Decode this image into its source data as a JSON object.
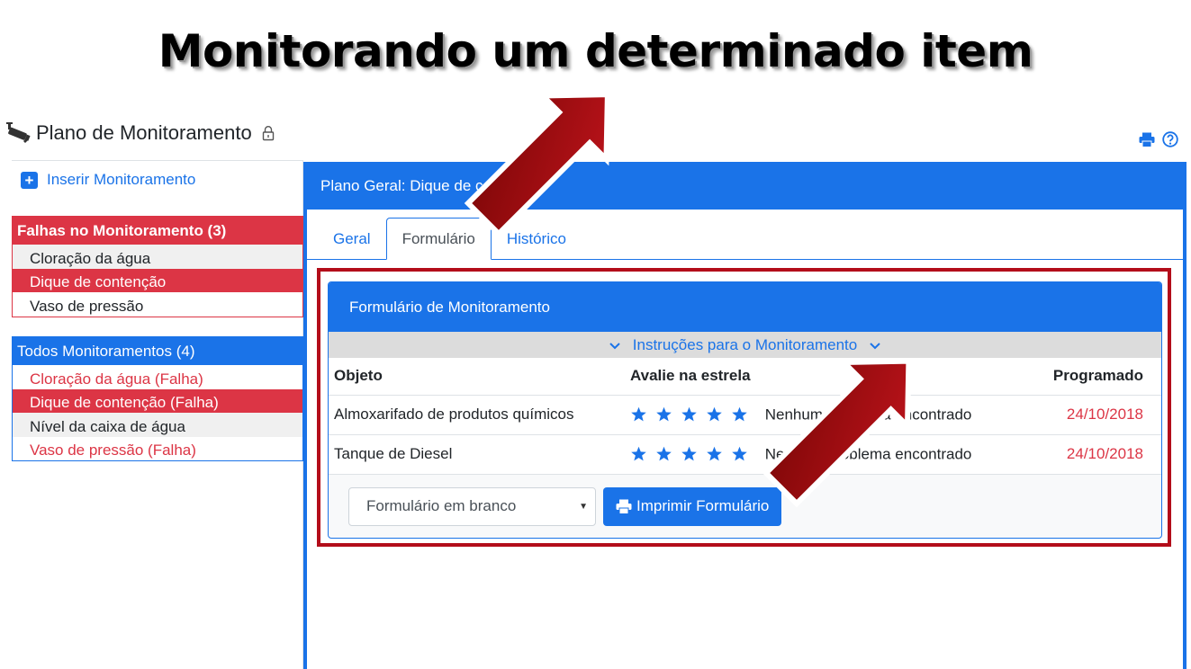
{
  "slide": {
    "title": "Monitorando um determinado item"
  },
  "header": {
    "title": "Plano de Monitoramento",
    "icons": [
      "cctv-camera-icon",
      "lock-icon",
      "print-icon",
      "help-icon"
    ]
  },
  "sidebar": {
    "insert_label": "Inserir Monitoramento",
    "failures": {
      "title": "Falhas no Monitoramento (3)",
      "items": [
        {
          "label": "Cloração da água"
        },
        {
          "label": "Dique de contenção",
          "active": true
        },
        {
          "label": "Vaso de pressão"
        }
      ]
    },
    "all": {
      "title": "Todos Monitoramentos (4)",
      "items": [
        {
          "label": "Cloração da água (Falha)"
        },
        {
          "label": "Dique de contenção (Falha)",
          "active": true
        },
        {
          "label": "Nível da caixa de água"
        },
        {
          "label": "Vaso de pressão (Falha)"
        }
      ]
    }
  },
  "main": {
    "header": "Plano Geral: Dique de c",
    "tabs": [
      {
        "label": "Geral"
      },
      {
        "label": "Formulário",
        "active": true
      },
      {
        "label": "Histórico"
      }
    ],
    "card": {
      "title": "Formulário de Monitoramento",
      "instructions": "Instruções para o Monitoramento",
      "columns": {
        "object": "Objeto",
        "rate": "Avalie na estrela",
        "scheduled": "Programado"
      },
      "rows": [
        {
          "object": "Almoxarifado de produtos químicos",
          "status": "Nenhum problema encontrado",
          "date": "24/10/2018",
          "stars": 5
        },
        {
          "object": "Tanque de Diesel",
          "status": "Nenhum problema encontrado",
          "date": "24/10/2018",
          "stars": 5
        }
      ],
      "select_value": "Formulário em branco",
      "print_label": "Imprimir Formulário"
    }
  },
  "colors": {
    "primary": "#1a73e8",
    "danger": "#dc3545",
    "highlight": "#b30d1a",
    "arrow": "#a30d0d"
  }
}
